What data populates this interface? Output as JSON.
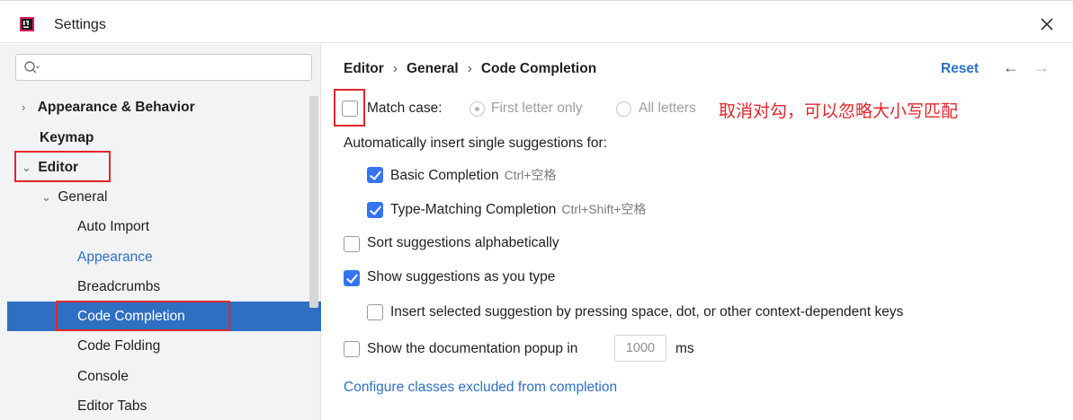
{
  "window": {
    "title": "Settings"
  },
  "search": {
    "placeholder": "",
    "value": ""
  },
  "sidebar": {
    "items": [
      {
        "label": "Appearance & Behavior",
        "arrow": "›"
      },
      {
        "label": "Keymap"
      },
      {
        "label": "Editor",
        "arrow": "⌄"
      },
      {
        "label": "General",
        "arrow": "⌄"
      },
      {
        "label": "Auto Import"
      },
      {
        "label": "Appearance"
      },
      {
        "label": "Breadcrumbs"
      },
      {
        "label": "Code Completion"
      },
      {
        "label": "Code Folding"
      },
      {
        "label": "Console"
      },
      {
        "label": "Editor Tabs"
      }
    ]
  },
  "breadcrumb": {
    "part1": "Editor",
    "part2": "General",
    "part3": "Code Completion",
    "separator": "›"
  },
  "header": {
    "reset_label": "Reset",
    "back_icon": "arrow-left-icon",
    "forward_icon": "arrow-right-icon"
  },
  "options": {
    "match_case_label": "Match case:",
    "match_case_checked": false,
    "first_letter_label": "First letter only",
    "all_letters_label": "All letters",
    "auto_insert_heading": "Automatically insert single suggestions for:",
    "basic_completion_label": "Basic Completion",
    "basic_completion_shortcut": "Ctrl+空格",
    "type_matching_label": "Type-Matching Completion",
    "type_matching_shortcut": "Ctrl+Shift+空格",
    "sort_label": "Sort suggestions alphabetically",
    "show_as_type_label": "Show suggestions as you type",
    "insert_selected_label": "Insert selected suggestion by pressing space, dot, or other context-dependent keys",
    "doc_popup_label": "Show the documentation popup in",
    "doc_popup_value": "1000",
    "doc_popup_unit": "ms",
    "configure_link": "Configure classes excluded from completion"
  },
  "annotation": {
    "text": "取消对勾，可以忽略大小写匹配",
    "color": "#e3262b"
  },
  "colors": {
    "accent": "#3574f0",
    "selection": "#2f6fc2",
    "link": "#2d6fc5",
    "highlight": "#e3262b"
  }
}
